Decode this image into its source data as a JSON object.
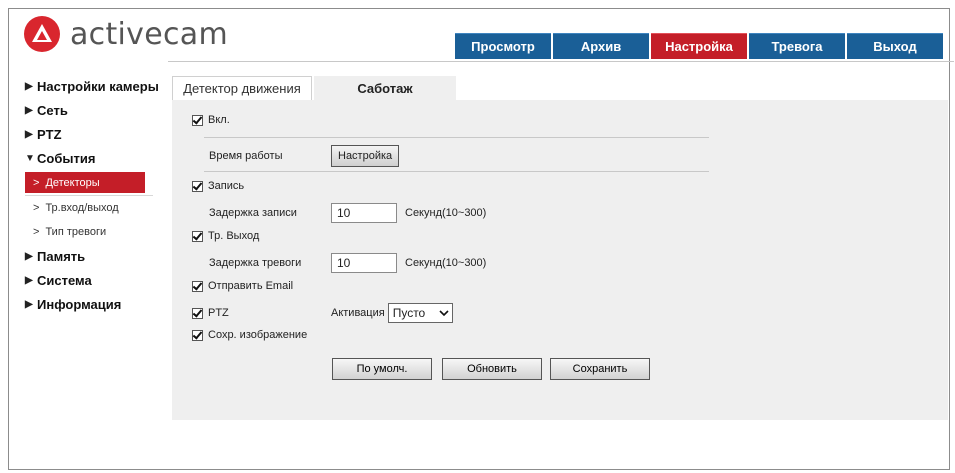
{
  "brand": {
    "name": "activecam",
    "logo_color": "#d9262e"
  },
  "nav": {
    "tabs": [
      {
        "label": "Просмотр"
      },
      {
        "label": "Архив"
      },
      {
        "label": "Настройка",
        "active": true
      },
      {
        "label": "Тревога"
      },
      {
        "label": "Выход"
      }
    ],
    "colors": {
      "tab": "#1a5f97",
      "active": "#c41e28"
    }
  },
  "sidebar": {
    "camera": "Настройки камеры",
    "network": "Сеть",
    "ptz": "PTZ",
    "events": "События",
    "detectors": "Детекторы",
    "io": "Тр.вход/выход",
    "alarm_type": "Тип тревоги",
    "storage": "Память",
    "system": "Система",
    "info": "Информация",
    "collapsed_icon": "triangle-right-icon",
    "expanded_icon": "triangle-down-icon"
  },
  "subtabs": {
    "motion": "Детектор движения",
    "sabotage": "Саботаж"
  },
  "form": {
    "enable_label": "Вкл.",
    "enable_checked": true,
    "schedule_label": "Время работы",
    "schedule_button": "Настройка",
    "record_label": "Запись",
    "record_checked": true,
    "record_delay_label": "Задержка записи",
    "record_delay_value": "10",
    "record_delay_unit": "Секунд(10~300)",
    "alarm_out_label": "Тр. Выход",
    "alarm_out_checked": true,
    "alarm_delay_label": "Задержка тревоги",
    "alarm_delay_value": "10",
    "alarm_delay_unit": "Секунд(10~300)",
    "email_label": "Отправить Email",
    "email_checked": true,
    "ptz_label": "PTZ",
    "ptz_checked": true,
    "activation_label": "Активация",
    "activation_value": "Пусто",
    "snapshot_label": "Сохр. изображение",
    "snapshot_checked": true
  },
  "buttons": {
    "default": "По умолч.",
    "refresh": "Обновить",
    "save": "Сохранить"
  }
}
